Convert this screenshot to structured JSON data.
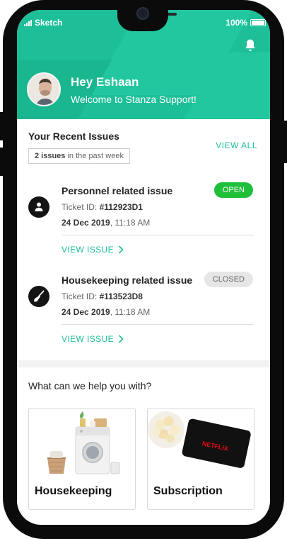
{
  "status_bar": {
    "carrier": "Sketch",
    "battery": "100%"
  },
  "header": {
    "greeting": "Hey Eshaan",
    "welcome": "Welcome to Stanza Support!",
    "bell_icon": "bell-icon",
    "avatar_icon": "user-avatar"
  },
  "recent": {
    "title": "Your Recent Issues",
    "view_all": "VIEW ALL",
    "week_count": "2 issues",
    "week_suffix": " in the past week"
  },
  "issues": [
    {
      "title": "Personnel related issue",
      "status": "OPEN",
      "ticket_label": "Ticket ID: ",
      "ticket_id": "#112923D1",
      "date_bold": "24 Dec 2019",
      "time": ", 11:18 AM",
      "view": "VIEW ISSUE",
      "icon": "person-icon",
      "status_color": "#1fbf3a"
    },
    {
      "title": "Housekeeping related issue",
      "status": "CLOSED",
      "ticket_label": "Ticket ID: ",
      "ticket_id": "#113523D8",
      "date_bold": "24 Dec 2019",
      "time": ", 11:18 AM",
      "view": "VIEW ISSUE",
      "icon": "broom-icon",
      "status_color": "#e6e6e6"
    }
  ],
  "help": {
    "title": "What can we help you with?",
    "cards": [
      {
        "label": "Housekeeping",
        "image": "washing-machine-illustration"
      },
      {
        "label": "Subscription",
        "image": "popcorn-netflix-card-illustration"
      }
    ],
    "netflix_logo": "NETFLIX"
  },
  "colors": {
    "accent": "#1dbf98",
    "open": "#1fbf3a",
    "closed": "#e6e6e6"
  }
}
